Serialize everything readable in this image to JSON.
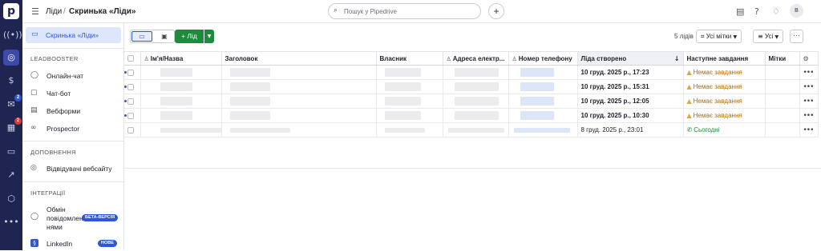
{
  "rail": {
    "logo": "p",
    "icons": [
      "broadcast-icon",
      "leads-inbox-icon",
      "deals-dollar-icon",
      "mail-icon",
      "calendar-icon",
      "card-icon",
      "insights-chart-icon",
      "products-box-icon",
      "more-dots-icon"
    ],
    "badges": {
      "mail": "2",
      "calendar": "2"
    }
  },
  "topbar": {
    "breadcrumb_root": "Ліди",
    "breadcrumb_sep": "/",
    "page_title": "Скринька «Ліди»",
    "search_placeholder": "Пошук у Pipedrive",
    "avatar_initial": "B"
  },
  "sidebar": {
    "active_item": "Скринька «Ліди»",
    "sections": {
      "leadbooster": "LEADBOOSTER",
      "addons": "ДОПОВНЕННЯ",
      "integrations": "ІНТЕГРАЦІЇ"
    },
    "leadbooster_items": [
      "Онлайн-чат",
      "Чат-бот",
      "Вебформи",
      "Prospector"
    ],
    "addon_items": [
      "Відвідувачі вебсайту"
    ],
    "integration_items": {
      "messaging_line1": "Обмін",
      "messaging_line2": "повідомлен",
      "messaging_line3": "нями",
      "beta_badge": "БЕТА-ВЕРСІЯ",
      "linkedin": "LinkedIn",
      "new_badge": "НОВЕ"
    }
  },
  "toolbar": {
    "add_label": "+ Лід",
    "count_label": "5 лідів",
    "labels_filter": "Усі мітки",
    "owner_filter": "Усі",
    "more": "···"
  },
  "table": {
    "columns": [
      "Ім'я/Назва",
      "Заголовок",
      "Власник",
      "Адреса електр...",
      "Номер телефону",
      "Ліда створено",
      "Наступне завдання",
      "Мітки"
    ],
    "rows": [
      {
        "created": "10 груд. 2025 р., 17:23",
        "task": "Немає завдання",
        "task_type": "warn",
        "unread": true
      },
      {
        "created": "10 груд. 2025 р., 15:31",
        "task": "Немає завдання",
        "task_type": "warn",
        "unread": true
      },
      {
        "created": "10 груд. 2025 р., 12:05",
        "task": "Немає завдання",
        "task_type": "warn",
        "unread": true
      },
      {
        "created": "10 груд. 2025 р., 10:30",
        "task": "Немає завдання",
        "task_type": "warn",
        "unread": true
      },
      {
        "created": "8 груд. 2025 р., 23:01",
        "task": "Сьогодні",
        "task_type": "ok",
        "unread": false
      }
    ],
    "row_menu": "•••"
  },
  "colors": {
    "rail_bg": "#1f2550",
    "accent": "#3156cf",
    "add_green": "#1e8a3c",
    "warning": "#e8a33a"
  }
}
